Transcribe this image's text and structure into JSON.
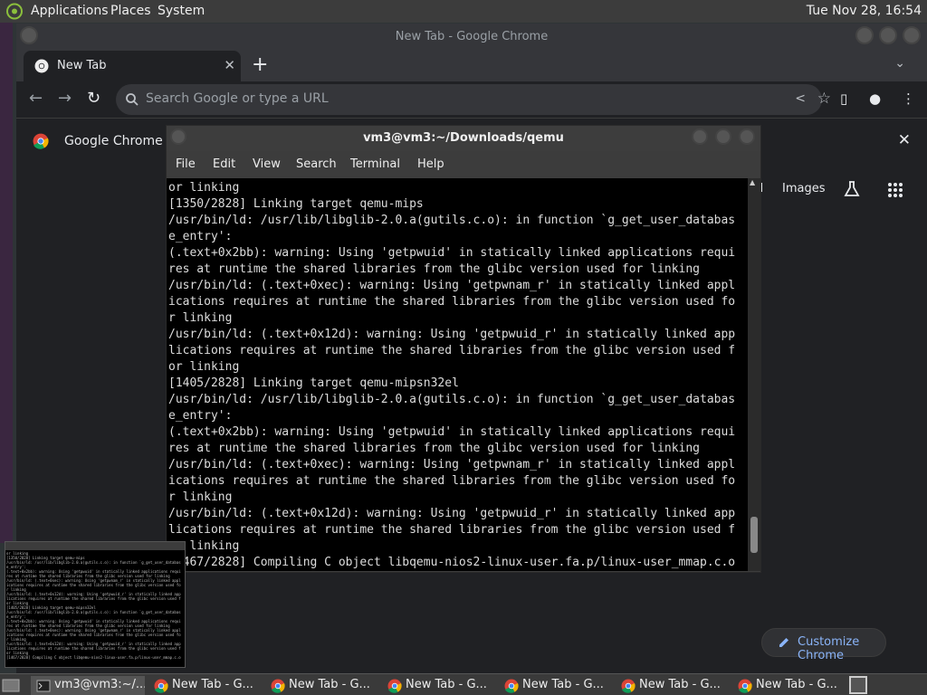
{
  "top_panel": {
    "menus": [
      "Applications",
      "Places",
      "System"
    ],
    "clock": "Tue Nov 28, 16:54"
  },
  "chrome": {
    "window_title": "New Tab - Google Chrome",
    "tab_label": "New Tab",
    "new_tab_symbol": "+",
    "omnibox_placeholder": "Search Google or type a URL",
    "infobar_text": "Google Chrome is",
    "ntp_links": {
      "gmail": "il",
      "images": "Images"
    },
    "customize_label": "Customize Chrome"
  },
  "terminal": {
    "title": "vm3@vm3:~/Downloads/qemu",
    "menus": [
      "File",
      "Edit",
      "View",
      "Search",
      "Terminal",
      "Help"
    ],
    "lines": [
      "or linking",
      "[1350/2828] Linking target qemu-mips",
      "/usr/bin/ld: /usr/lib/libglib-2.0.a(gutils.c.o): in function `g_get_user_databas",
      "e_entry':",
      "(.text+0x2bb): warning: Using 'getpwuid' in statically linked applications requi",
      "res at runtime the shared libraries from the glibc version used for linking",
      "/usr/bin/ld: (.text+0xec): warning: Using 'getpwnam_r' in statically linked appl",
      "ications requires at runtime the shared libraries from the glibc version used fo",
      "r linking",
      "/usr/bin/ld: (.text+0x12d): warning: Using 'getpwuid_r' in statically linked app",
      "lications requires at runtime the shared libraries from the glibc version used f",
      "or linking",
      "[1405/2828] Linking target qemu-mipsn32el",
      "/usr/bin/ld: /usr/lib/libglib-2.0.a(gutils.c.o): in function `g_get_user_databas",
      "e_entry':",
      "(.text+0x2bb): warning: Using 'getpwuid' in statically linked applications requi",
      "res at runtime the shared libraries from the glibc version used for linking",
      "/usr/bin/ld: (.text+0xec): warning: Using 'getpwnam_r' in statically linked appl",
      "ications requires at runtime the shared libraries from the glibc version used fo",
      "r linking",
      "/usr/bin/ld: (.text+0x12d): warning: Using 'getpwuid_r' in statically linked app",
      "lications requires at runtime the shared libraries from the glibc version used f",
      "or linking",
      "[1467/2828] Compiling C object libqemu-nios2-linux-user.fa.p/linux-user_mmap.c.o"
    ]
  },
  "taskbar": {
    "items": [
      {
        "label": "vm3@vm3:~/...",
        "icon": "terminal-icon"
      },
      {
        "label": "New Tab - G...",
        "icon": "chrome-icon"
      },
      {
        "label": "New Tab - G...",
        "icon": "chrome-icon"
      },
      {
        "label": "New Tab - G...",
        "icon": "chrome-icon"
      },
      {
        "label": "New Tab - G...",
        "icon": "chrome-icon"
      },
      {
        "label": "New Tab - G...",
        "icon": "chrome-icon"
      },
      {
        "label": "New Tab - G...",
        "icon": "chrome-icon"
      }
    ]
  },
  "colors": {
    "accent": "#8ab4f8",
    "terminal_bg": "#000000"
  }
}
